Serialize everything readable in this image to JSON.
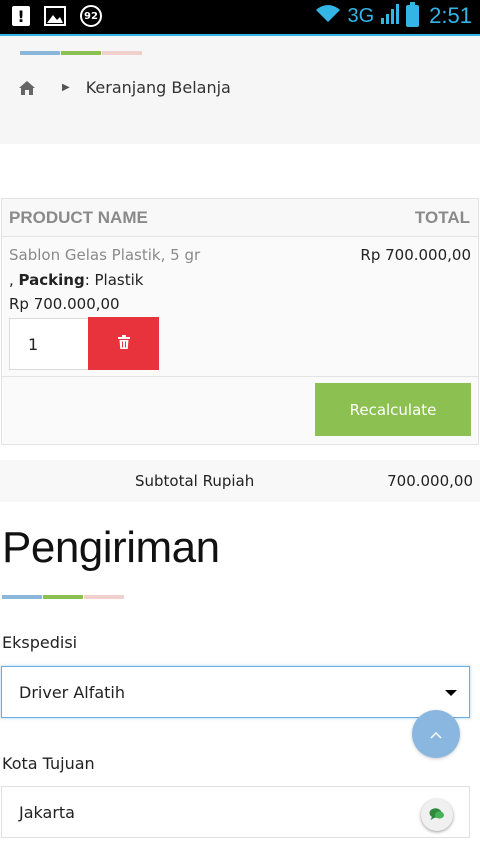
{
  "status_bar": {
    "notification_badge": "92",
    "network": "3G",
    "time": "2:51"
  },
  "breadcrumb": {
    "current": "Keranjang Belanja"
  },
  "cart": {
    "headers": {
      "product": "PRODUCT NAME",
      "total": "TOTAL"
    },
    "item": {
      "name": "Sablon Gelas Plastik, 5 gr",
      "option_prefix": ", ",
      "option_label": "Packing",
      "option_value": ": Plastik",
      "unit_price": "Rp 700.000,00",
      "total": "Rp 700.000,00",
      "quantity": "1"
    },
    "recalculate_label": "Recalculate"
  },
  "subtotal": {
    "label": "Subtotal Rupiah",
    "value": "700.000,00"
  },
  "shipping": {
    "title": "Pengiriman",
    "courier_label": "Ekspedisi",
    "courier_value": "Driver Alfatih",
    "city_label": "Kota Tujuan",
    "city_value": "Jakarta"
  },
  "colors": {
    "accent_blue": "#8ab7d9",
    "accent_green": "#8cc152",
    "accent_pink": "#f0d0cc",
    "delete_red": "#e8323c"
  }
}
